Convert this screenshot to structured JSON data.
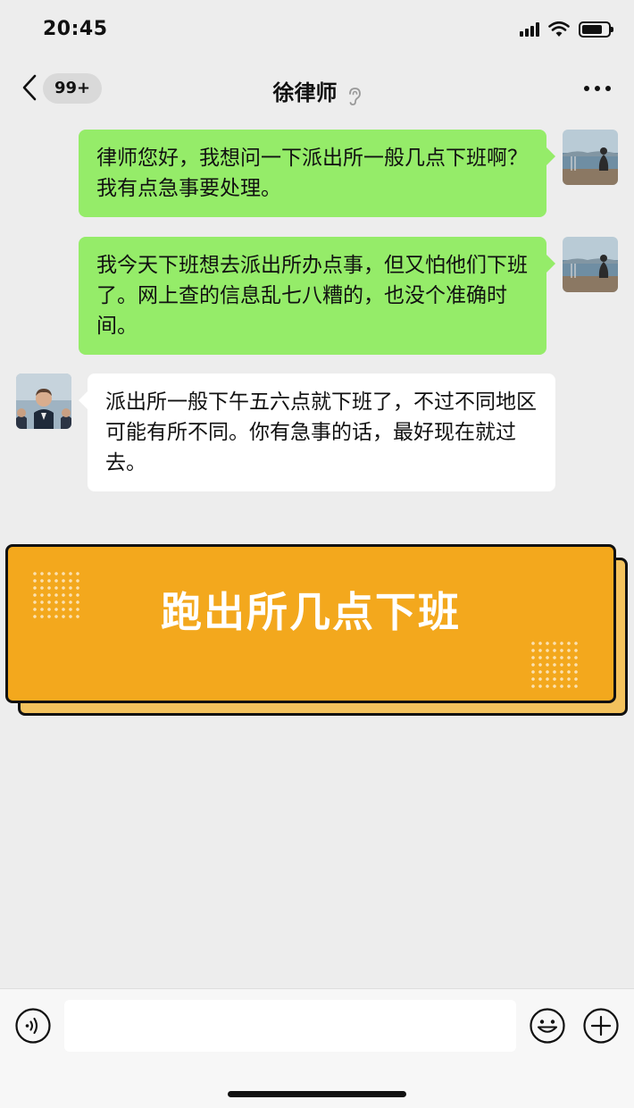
{
  "status": {
    "time": "20:45"
  },
  "nav": {
    "back_badge": "99+",
    "title": "徐律师"
  },
  "messages": [
    {
      "side": "right",
      "text": "律师您好，我想问一下派出所一般几点下班啊？我有点急事要处理。"
    },
    {
      "side": "right",
      "text": "我今天下班想去派出所办点事，但又怕他们下班了。网上查的信息乱七八糟的，也没个准确时间。"
    },
    {
      "side": "left",
      "text": "派出所一般下午五六点就下班了，不过不同地区可能有所不同。你有急事的话，最好现在就过去。"
    }
  ],
  "banner": {
    "title": "跑出所几点下班"
  },
  "input": {
    "value": "",
    "placeholder": ""
  },
  "colors": {
    "background": "#ededed",
    "sent_bubble": "#95ec69",
    "received_bubble": "#ffffff",
    "banner": "#f3a81d",
    "banner_shadow": "#f3c25d"
  }
}
